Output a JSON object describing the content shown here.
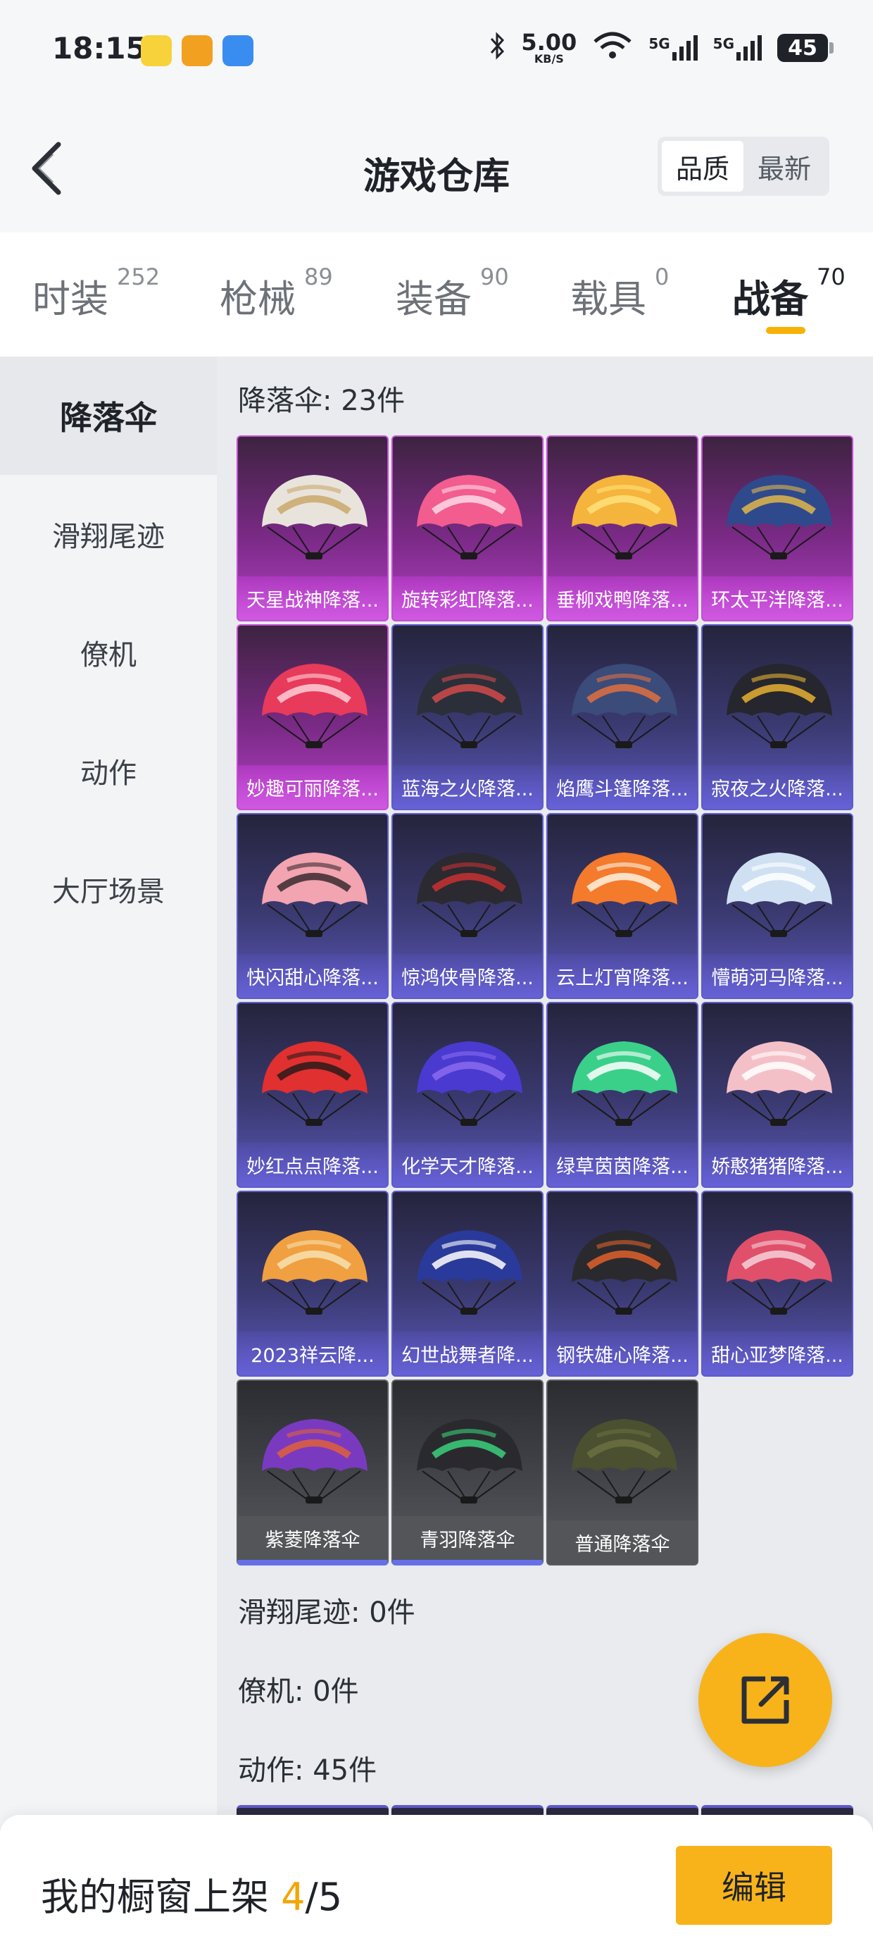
{
  "status_bar": {
    "time": "18:15",
    "net_speed_value": "5.00",
    "net_speed_unit": "KB/S",
    "signal_1": "5G",
    "signal_2": "5G",
    "battery": "45",
    "icons": [
      "app-icon-1",
      "app-icon-2",
      "app-icon-3",
      "bluetooth-icon",
      "wifi-icon",
      "signal-icon",
      "signal-icon",
      "battery-icon"
    ]
  },
  "header": {
    "title": "游戏仓库",
    "sort_options": [
      "品质",
      "最新"
    ],
    "sort_active": "品质"
  },
  "tabs": [
    {
      "label": "时装",
      "count": "252"
    },
    {
      "label": "枪械",
      "count": "89"
    },
    {
      "label": "装备",
      "count": "90"
    },
    {
      "label": "载具",
      "count": "0"
    },
    {
      "label": "战备",
      "count": "70",
      "active": true
    }
  ],
  "sidebar": {
    "items": [
      "降落伞",
      "滑翔尾迹",
      "僚机",
      "动作",
      "大厅场景"
    ],
    "active": "降落伞"
  },
  "sections": {
    "parachute_label": "降落伞: 23件",
    "trail_label": "滑翔尾迹: 0件",
    "wingman_label": "僚机: 0件",
    "action_label": "动作: 45件"
  },
  "items": [
    {
      "name": "天星战神降落...",
      "rarity": "purple",
      "colors": [
        "#e8e4dc",
        "#c9a86a"
      ]
    },
    {
      "name": "旋转彩虹降落...",
      "rarity": "purple",
      "colors": [
        "#f25c8f",
        "#ffd9e6"
      ]
    },
    {
      "name": "垂柳戏鸭降落...",
      "rarity": "purple",
      "colors": [
        "#f5b43c",
        "#ffe27a"
      ]
    },
    {
      "name": "环太平洋降落...",
      "rarity": "purple",
      "colors": [
        "#2e4a8c",
        "#e0b64a"
      ]
    },
    {
      "name": "妙趣可丽降落...",
      "rarity": "purple",
      "colors": [
        "#e83a5a",
        "#ffd0d8"
      ]
    },
    {
      "name": "蓝海之火降落...",
      "rarity": "blue",
      "colors": [
        "#2b2f3a",
        "#d24a4a"
      ]
    },
    {
      "name": "焰鹰斗篷降落...",
      "rarity": "blue",
      "colors": [
        "#3b4b7a",
        "#e07040"
      ]
    },
    {
      "name": "寂夜之火降落...",
      "rarity": "blue",
      "colors": [
        "#26262e",
        "#e6b030"
      ]
    },
    {
      "name": "快闪甜心降落...",
      "rarity": "blue",
      "colors": [
        "#f2a4b0",
        "#3a2a30"
      ]
    },
    {
      "name": "惊鸿侠骨降落...",
      "rarity": "blue",
      "colors": [
        "#2a2a30",
        "#c83030"
      ]
    },
    {
      "name": "云上灯宵降落...",
      "rarity": "blue",
      "colors": [
        "#f47a2c",
        "#fff2e0"
      ]
    },
    {
      "name": "懵萌河马降落...",
      "rarity": "blue",
      "colors": [
        "#cfe0f2",
        "#ffffff"
      ]
    },
    {
      "name": "妙红点点降落...",
      "rarity": "blue",
      "colors": [
        "#e03030",
        "#2a1a1a"
      ]
    },
    {
      "name": "化学天才降落...",
      "rarity": "blue",
      "colors": [
        "#4a3ad0",
        "#8a6af0"
      ]
    },
    {
      "name": "绿草茵茵降落...",
      "rarity": "blue",
      "colors": [
        "#3ad08a",
        "#ffffff"
      ]
    },
    {
      "name": "娇憨猪猪降落...",
      "rarity": "blue",
      "colors": [
        "#f4c0c8",
        "#ffffff"
      ]
    },
    {
      "name": "2023祥云降...",
      "rarity": "blue",
      "colors": [
        "#f0a040",
        "#f7e0b0"
      ]
    },
    {
      "name": "幻世战舞者降...",
      "rarity": "blue",
      "colors": [
        "#2a3a9a",
        "#ffffff"
      ]
    },
    {
      "name": "钢铁雄心降落...",
      "rarity": "blue",
      "colors": [
        "#2a2a2e",
        "#e0602a"
      ]
    },
    {
      "name": "甜心亚梦降落...",
      "rarity": "blue",
      "colors": [
        "#e0506a",
        "#f4d0d8"
      ]
    },
    {
      "name": "紫菱降落伞",
      "rarity": "grey",
      "colors": [
        "#7a3ac0",
        "#e0603a"
      ]
    },
    {
      "name": "青羽降落伞",
      "rarity": "grey",
      "colors": [
        "#2a2a2e",
        "#3ad07a"
      ]
    },
    {
      "name": "普通降落伞",
      "rarity": "grey",
      "colors": [
        "#4a5030",
        "#6a7040"
      ]
    }
  ],
  "bottom_bar": {
    "showcase_prefix": "我的橱窗上架 ",
    "showcase_current": "4",
    "showcase_total": "/5",
    "edit_label": "编辑"
  },
  "colors": {
    "accent": "#f8b31a",
    "purple_card": "#c34fd4",
    "blue_card": "#5e5bc9",
    "grey_card": "#5b5c62"
  }
}
